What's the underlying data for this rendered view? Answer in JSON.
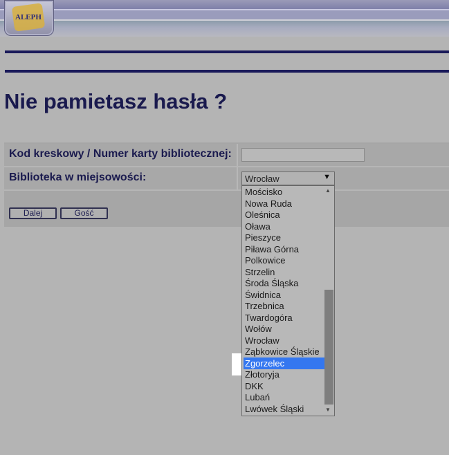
{
  "header": {
    "logo_text": "ALEPH"
  },
  "page_title": "Nie pamietasz hasła ?",
  "form": {
    "barcode_label": "Kod kreskowy / Numer karty bibliotecznej:",
    "barcode_value": "",
    "library_label": "Biblioteka w miejsowości:",
    "library_selected": "Wrocław"
  },
  "buttons": {
    "next": "Dalej",
    "guest": "Gość"
  },
  "dropdown": {
    "options": [
      "Mościsko",
      "Nowa Ruda",
      "Oleśnica",
      "Oława",
      "Pieszyce",
      "Piława Górna",
      "Polkowice",
      "Strzelin",
      "Środa Śląska",
      "Świdnica",
      "Trzebnica",
      "Twardogóra",
      "Wołów",
      "Wrocław",
      "Ząbkowice Śląskie",
      "Zgorzelec",
      "Złotoryja",
      "DKK",
      "Lubań",
      "Lwówek Śląski"
    ],
    "highlighted": "Zgorzelec",
    "highlight_color": "#3477f0"
  }
}
